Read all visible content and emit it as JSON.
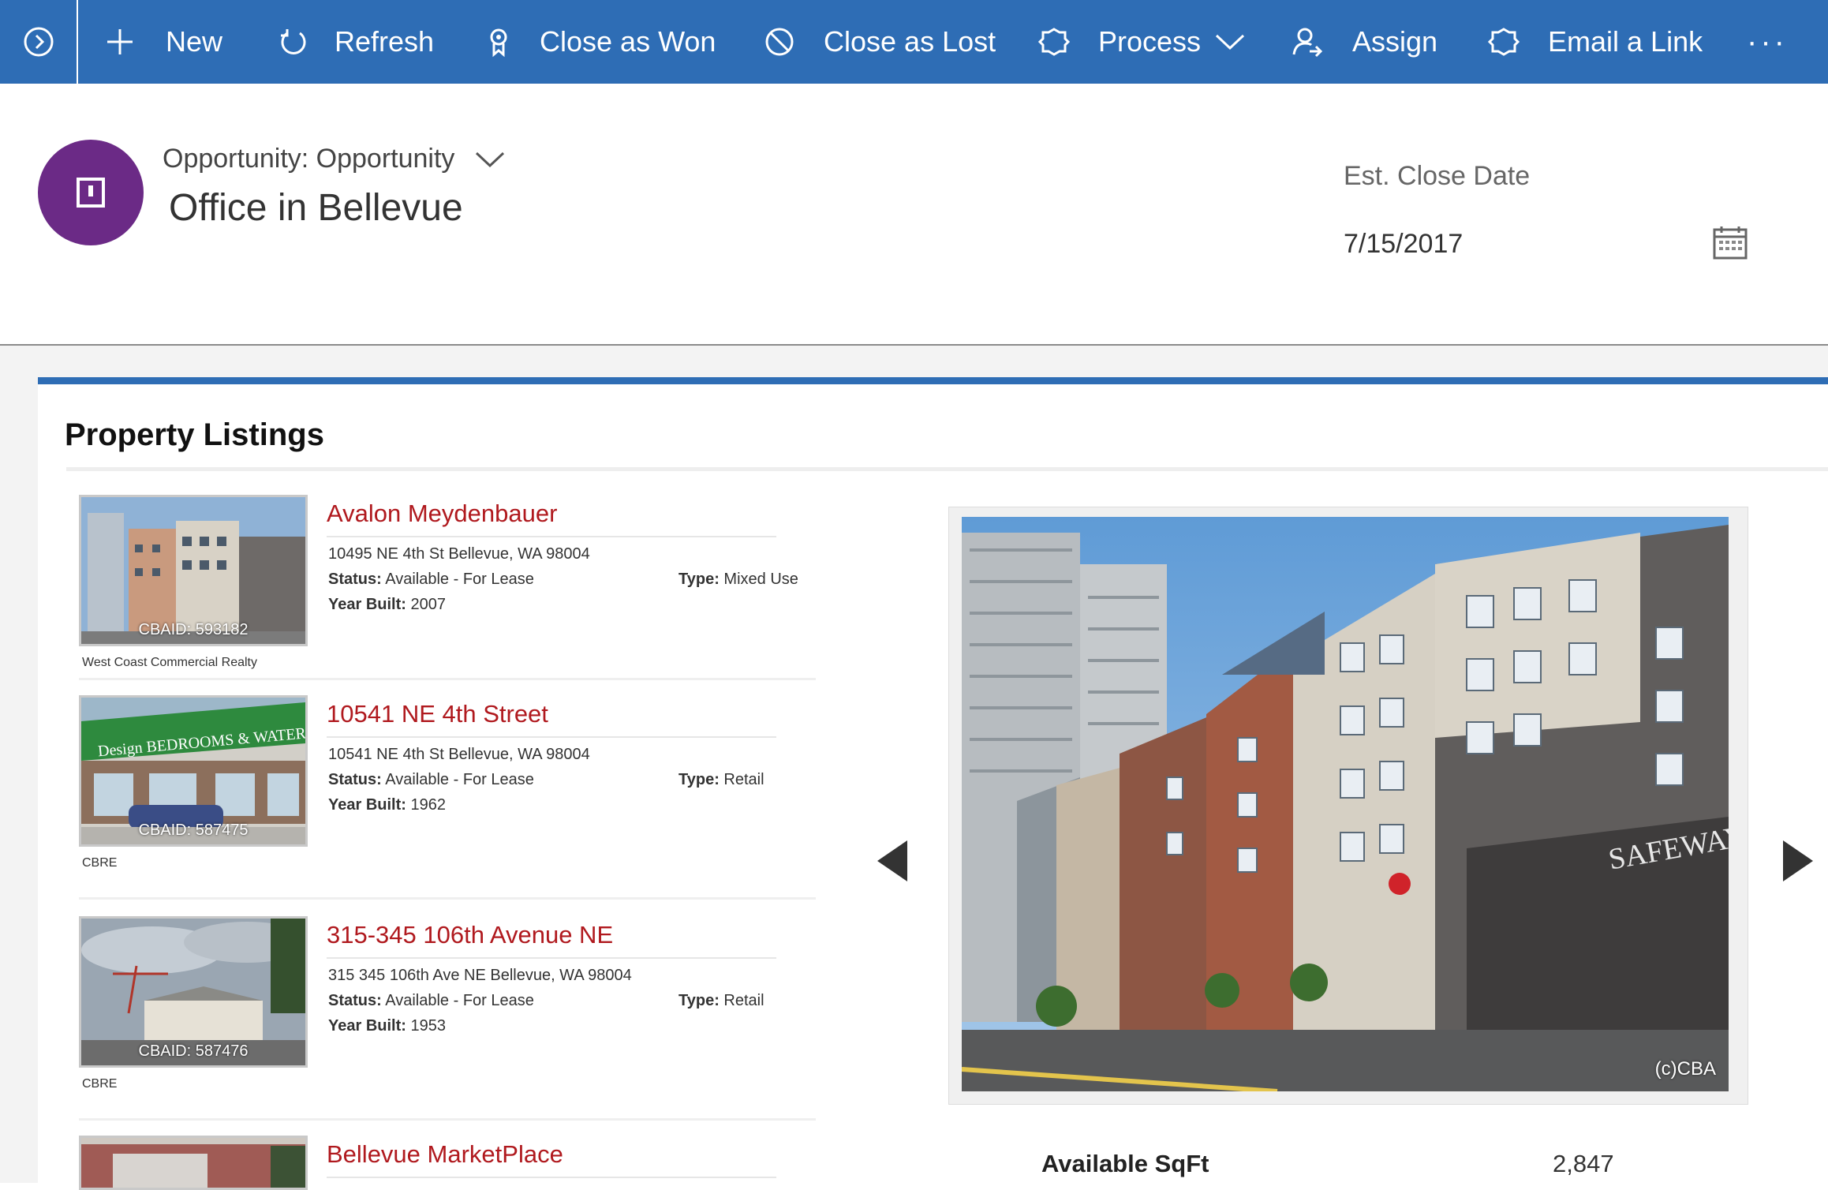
{
  "commandbar": {
    "items": [
      {
        "label": "New",
        "icon": "plus-icon"
      },
      {
        "label": "Refresh",
        "icon": "refresh-icon"
      },
      {
        "label": "Close as Won",
        "icon": "ribbon-icon"
      },
      {
        "label": "Close as Lost",
        "icon": "block-icon"
      },
      {
        "label": "Process",
        "icon": "process-icon"
      },
      {
        "label": "Assign",
        "icon": "assign-icon"
      },
      {
        "label": "Email a Link",
        "icon": "email-link-icon"
      }
    ],
    "more": "···"
  },
  "header": {
    "entity_type": "Opportunity: Opportunity",
    "title": "Office in Bellevue",
    "close_date_label": "Est. Close Date",
    "close_date_value": "7/15/2017"
  },
  "listings": {
    "title": "Property Listings",
    "status_label": "Status:",
    "type_label": "Type:",
    "year_label": "Year Built:",
    "items": [
      {
        "name": "Avalon Meydenbauer",
        "address": "10495 NE 4th St Bellevue, WA 98004",
        "status": "Available - For Lease",
        "type": "Mixed Use",
        "year": "2007",
        "cbaid": "CBAID: 593182",
        "broker": "West Coast Commercial Realty"
      },
      {
        "name": "10541 NE 4th Street",
        "address": "10541 NE 4th St Bellevue, WA 98004",
        "status": "Available - For Lease",
        "type": "Retail",
        "year": "1962",
        "cbaid": "CBAID: 587475",
        "broker": "CBRE"
      },
      {
        "name": "315-345 106th Avenue NE",
        "address": "315 345 106th Ave NE Bellevue, WA 98004",
        "status": "Available - For Lease",
        "type": "Retail",
        "year": "1953",
        "cbaid": "CBAID: 587476",
        "broker": "CBRE"
      },
      {
        "name": "Bellevue MarketPlace"
      }
    ]
  },
  "detail": {
    "copyright": "(c)CBA",
    "stat_label": "Available SqFt",
    "stat_value": "2,847"
  },
  "colors": {
    "commandbar": "#2e6db5",
    "avatar": "#6b2a86",
    "listing_title": "#b0191e"
  }
}
